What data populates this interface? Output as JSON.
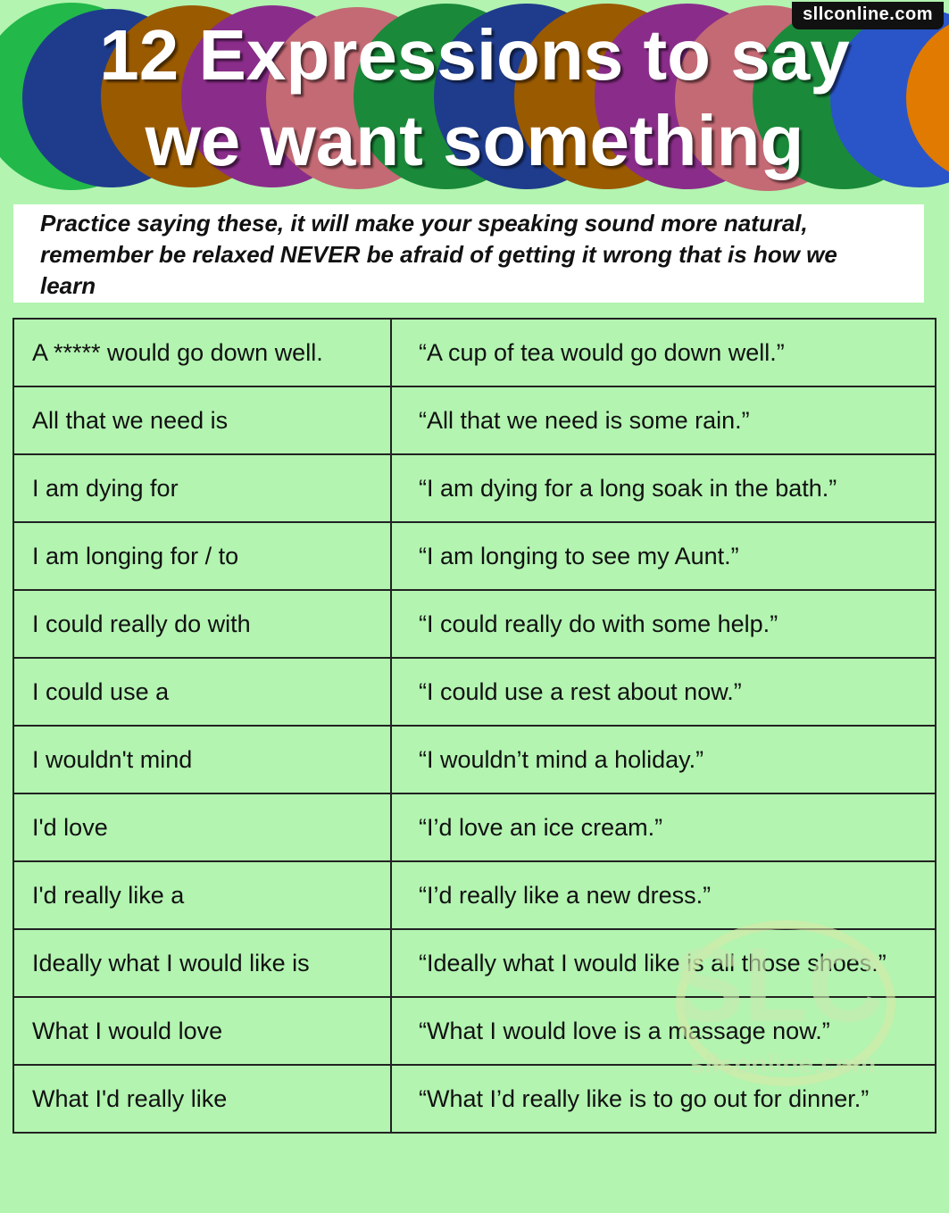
{
  "site_badge": "sllconline.com",
  "title": {
    "line1": "12 Expressions to say",
    "line2": "we want something"
  },
  "intro": "Practice saying these, it will make your speaking sound more natural, remember be relaxed NEVER be afraid of getting it wrong that is how we learn",
  "rows": [
    {
      "phrase": "A  *****  would go down well.",
      "example": "“A cup of tea would go down well.”"
    },
    {
      "phrase": "All that we need is",
      "example": "“All that we need is some rain.”"
    },
    {
      "phrase": "I am dying for",
      "example": "“I am dying for a long soak in the bath.”"
    },
    {
      "phrase": "I am longing for / to",
      "example": "“I am longing to see my Aunt.”"
    },
    {
      "phrase": "I could really do with",
      "example": "“I could really do with some help.”"
    },
    {
      "phrase": "I could use a",
      "example": "“I could use a rest about now.”"
    },
    {
      "phrase": "I wouldn't mind",
      "example": "“I wouldn’t mind a holiday.”"
    },
    {
      "phrase": "I'd love",
      "example": "“I’d love an ice cream.”"
    },
    {
      "phrase": "I'd really like a",
      "example": "“I’d really like a new dress.”"
    },
    {
      "phrase": "Ideally what I would like is",
      "example": "“Ideally what I would like is all those shoes.”"
    },
    {
      "phrase": "What I would love",
      "example": "“What I would love is a massage now.”"
    },
    {
      "phrase": "What I'd really like",
      "example": "“What I’d really like is to go out for dinner.”"
    }
  ],
  "watermark": {
    "letters": "SLC",
    "text": "sllconline.com"
  },
  "colors": {
    "background": "#b2f4b0",
    "circles": [
      "#22b84a",
      "#1f3c8c",
      "#9a5a00",
      "#8a2d8a",
      "#c46a74",
      "#1a8a3a",
      "#1f3c8c",
      "#9a5a00",
      "#8a2d8a",
      "#c46a74",
      "#1a8a3a",
      "#2a55c8",
      "#e07a00"
    ]
  }
}
